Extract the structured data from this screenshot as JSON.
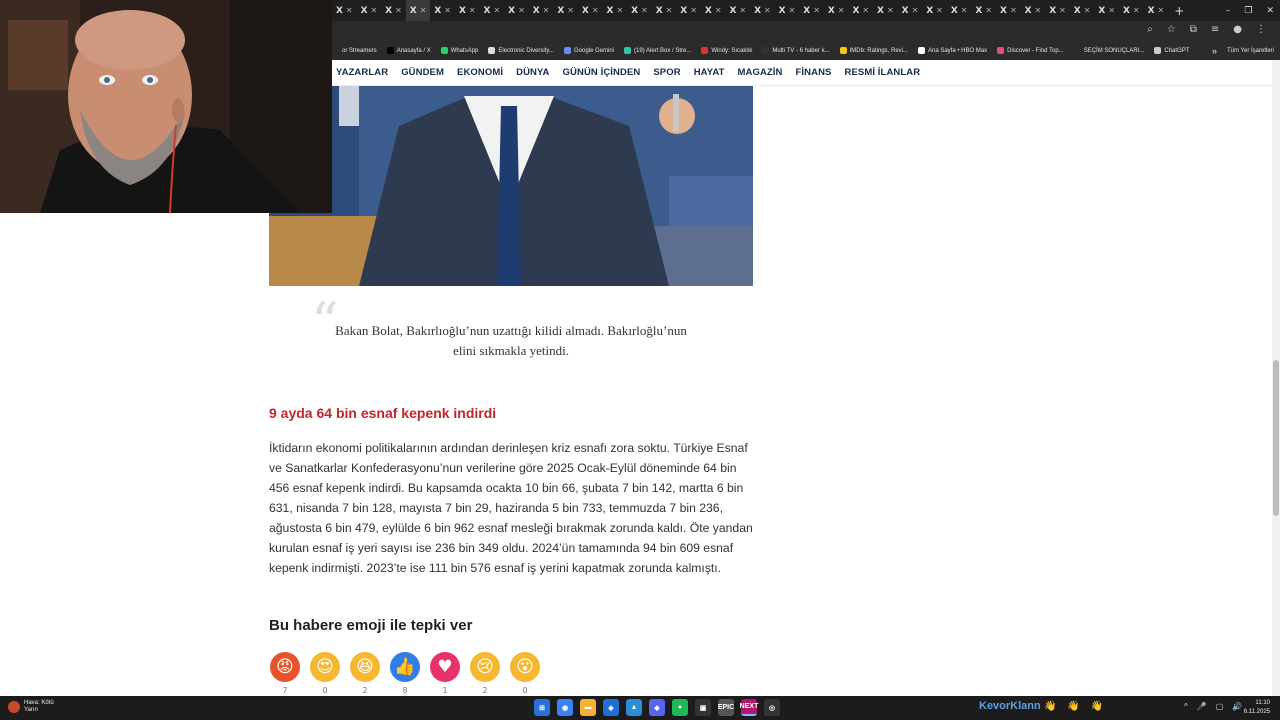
{
  "browser": {
    "tabs": [
      {
        "label": "X",
        "active": false
      },
      {
        "label": "X",
        "active": false
      },
      {
        "label": "X",
        "active": false
      },
      {
        "label": "X",
        "active": true
      },
      {
        "label": "X",
        "active": false
      },
      {
        "label": "X",
        "active": false
      },
      {
        "label": "X",
        "active": false
      },
      {
        "label": "X",
        "active": false
      },
      {
        "label": "X",
        "active": false
      },
      {
        "label": "X",
        "active": false
      },
      {
        "label": "X",
        "active": false
      },
      {
        "label": "X",
        "active": false
      },
      {
        "label": "X",
        "active": false
      },
      {
        "label": "X",
        "active": false
      },
      {
        "label": "X",
        "active": false
      },
      {
        "label": "X",
        "active": false
      },
      {
        "label": "X",
        "active": false
      },
      {
        "label": "X",
        "active": false
      },
      {
        "label": "X",
        "active": false
      },
      {
        "label": "X",
        "active": false
      },
      {
        "label": "X",
        "active": false
      },
      {
        "label": "X",
        "active": false
      },
      {
        "label": "X",
        "active": false
      },
      {
        "label": "X",
        "active": false
      },
      {
        "label": "X",
        "active": false
      },
      {
        "label": "X",
        "active": false
      },
      {
        "label": "X",
        "active": false
      },
      {
        "label": "X",
        "active": false
      },
      {
        "label": "X",
        "active": false
      },
      {
        "label": "X",
        "active": false
      },
      {
        "label": "X",
        "active": false
      },
      {
        "label": "X",
        "active": false
      },
      {
        "label": "X",
        "active": false
      },
      {
        "label": "X",
        "active": false
      }
    ],
    "new_tab": "+",
    "window_controls": [
      "–",
      "❐",
      "✕"
    ],
    "bookmarks": [
      {
        "label": "or Streamers",
        "icon": "blank",
        "color": "#2b2b2b"
      },
      {
        "label": "Anasayfa / X",
        "icon": "x-icon",
        "color": "#000000"
      },
      {
        "label": "WhatsApp",
        "icon": "whatsapp-icon",
        "color": "#25d366"
      },
      {
        "label": "Electronic Diversity...",
        "icon": "page-icon",
        "color": "#dddddd"
      },
      {
        "label": "Google Gemini",
        "icon": "gemini-icon",
        "color": "#6a8cf0"
      },
      {
        "label": "(19) Alert Box / Stre...",
        "icon": "alertbox-icon",
        "color": "#31c3a2"
      },
      {
        "label": "Windy: Sıcaklık",
        "icon": "windy-icon",
        "color": "#d33"
      },
      {
        "label": "Multi TV - 6 haber k...",
        "icon": "tv-icon",
        "color": "#333333"
      },
      {
        "label": "IMDb: Ratings, Revi...",
        "icon": "imdb-icon",
        "color": "#f5c518"
      },
      {
        "label": "Ana Sayfa • HBO Max",
        "icon": "hbo-icon",
        "color": "#ffffff"
      },
      {
        "label": "Discover - Find Top...",
        "icon": "discover-icon",
        "color": "#e84a7a"
      },
      {
        "label": "SEÇİM SONUÇLARI...",
        "icon": "blank",
        "color": "#2b2b2b"
      },
      {
        "label": "ChatGPT",
        "icon": "chatgpt-icon",
        "color": "#cccccc"
      }
    ],
    "bookmarks_more": "»",
    "bookmarks_all": "Tüm Yer İşaretleri"
  },
  "site_nav": [
    "YAZARLAR",
    "GÜNDEM",
    "EKONOMİ",
    "DÜNYA",
    "GÜNÜN İÇİNDEN",
    "SPOR",
    "HAYAT",
    "MAGAZİN",
    "FİNANS",
    "RESMİ İLANLAR"
  ],
  "article": {
    "quote_mark": "“",
    "quote": "Bakan Bolat, Bakırlıoğlu’nun uzattığı kilidi almadı. Bakırloğlu’nun elini sıkmakla yetindi.",
    "subheading": "9 ayda 64 bin esnaf kepenk indirdi",
    "body": "İktidarın ekonomi politikalarının ardından derinleşen kriz esnafı zora soktu. Türkiye Esnaf ve Sanatkarlar Konfederasyonu’nun verilerine göre 2025 Ocak-Eylül döneminde 64 bin 456 esnaf kepenk indirdi. Bu kapsamda ocakta 10 bin 66, şubata 7 bin 142, martta 6 bin 631, nisanda 7 bin 128, mayısta 7 bin 29, haziranda 5 bin 733, temmuzda 7 bin 236, ağustosta 6 bin 479, eylülde 6 bin 962 esnaf mesleği bırakmak zorunda kaldı. Öte yandan kurulan esnaf iş yeri sayısı ise 236 bin 349 oldu. 2024’ün tamamında 94 bin 609 esnaf kepenk indirmişti. 2023’te ise 111 bin 576 esnaf iş yerini kapatmak zorunda kalmıştı.",
    "reaction_title": "Bu habere emoji ile tepki ver",
    "reactions": [
      {
        "name": "angry",
        "glyph": "😡",
        "count": "7",
        "color": "#e8542a"
      },
      {
        "name": "love-eyes",
        "glyph": "😍",
        "count": "0",
        "color": "#f5b82e"
      },
      {
        "name": "laugh",
        "glyph": "😆",
        "count": "2",
        "color": "#f5b82e"
      },
      {
        "name": "like",
        "glyph": "👍",
        "count": "8",
        "color": "#2f7fe6"
      },
      {
        "name": "heart",
        "glyph": "♥",
        "count": "1",
        "color": "#e8336a"
      },
      {
        "name": "sad",
        "glyph": "😢",
        "count": "2",
        "color": "#f5b82e"
      },
      {
        "name": "wow",
        "glyph": "😮",
        "count": "0",
        "color": "#f5b82e"
      }
    ]
  },
  "taskbar": {
    "weather_label": "Hava: Kötü",
    "weather_sub": "Yarın",
    "apps": [
      "⊞",
      "◉",
      "▬",
      "◈",
      "▲",
      "◆",
      "●",
      "▣",
      "EPIC",
      "NEXT",
      "◎"
    ],
    "streamer_name": "KevorKlann",
    "hands": "👋 👋 👋",
    "tray": [
      "^",
      "🎤",
      "▢",
      "🔊"
    ],
    "time": "11:10",
    "date": "6.11.2025"
  }
}
